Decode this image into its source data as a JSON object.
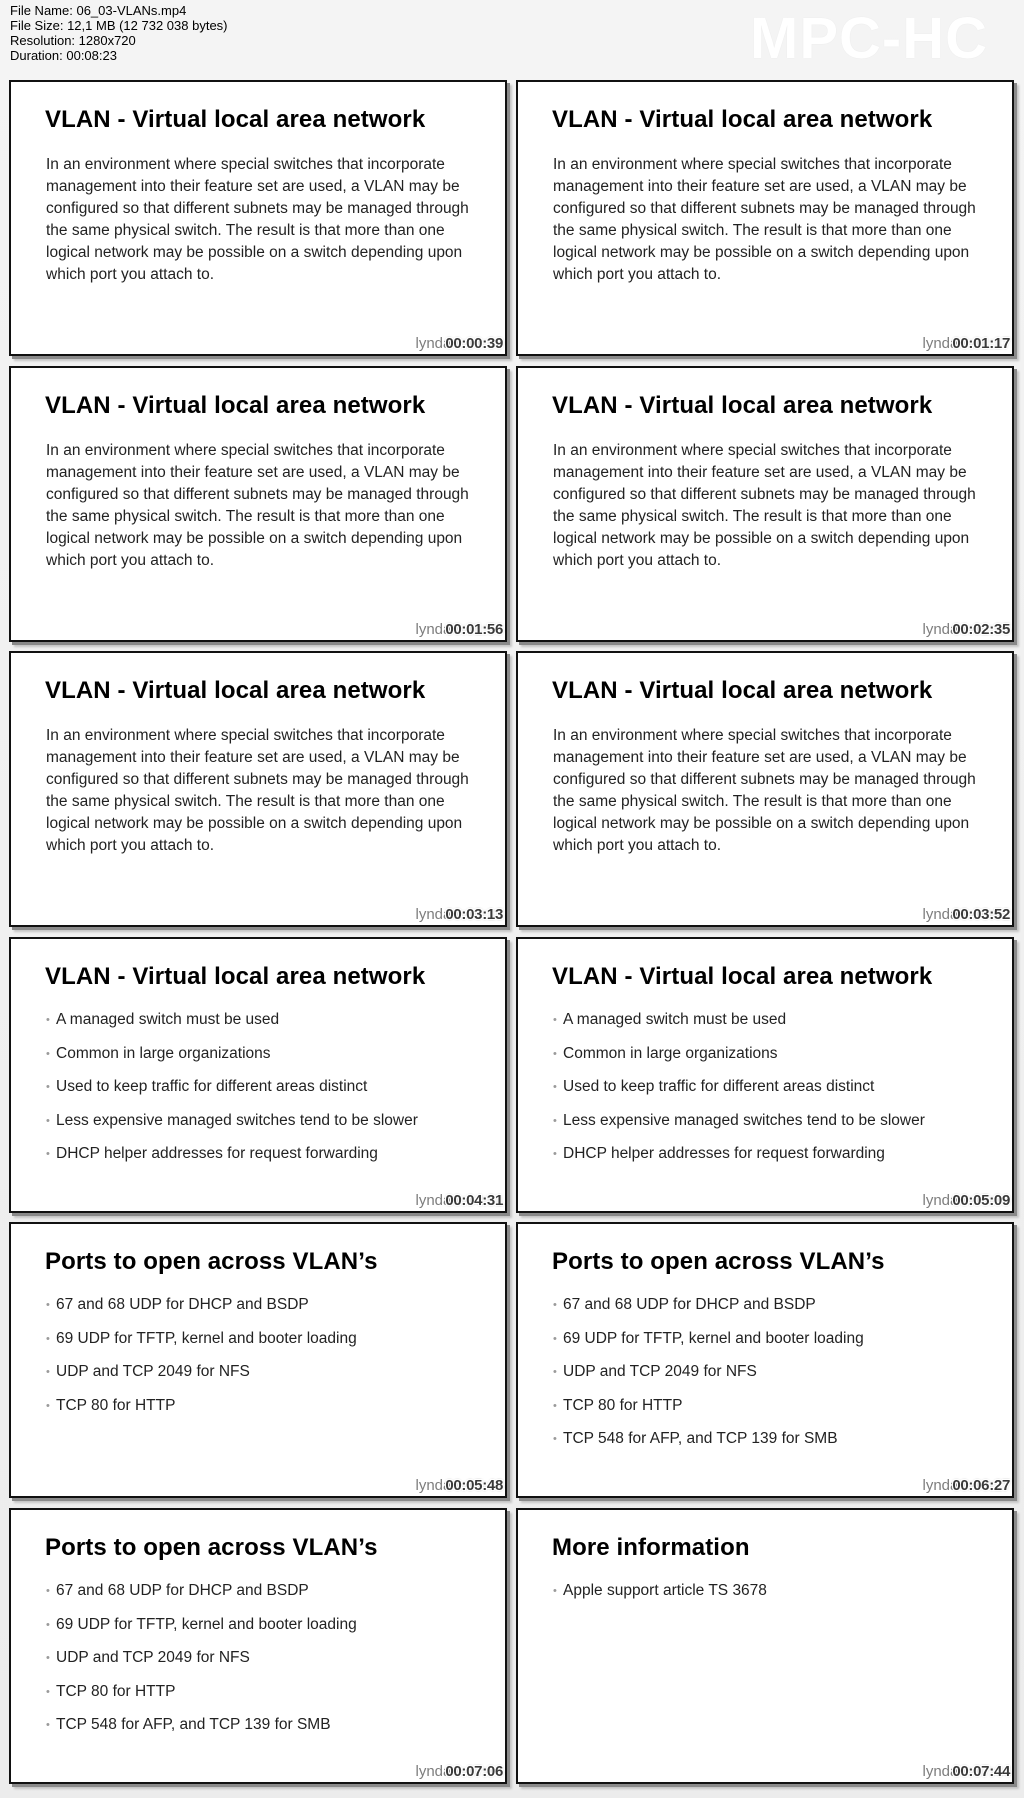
{
  "header": {
    "file_name_label": "File Name: 06_03-VLANs.mp4",
    "file_size_label": "File Size: 12,1 MB (12 732 038 bytes)",
    "resolution_label": "Resolution: 1280x720",
    "duration_label": "Duration: 00:08:23",
    "brand": "MPC-HC"
  },
  "watermark": "lynda",
  "frames": [
    {
      "title": "VLAN - Virtual local area network",
      "type": "paragraph",
      "text": "In an environment where special switches that incorporate management into their feature set are used, a VLAN may be configured so that different subnets may be managed through the same physical switch. The result is that more than one logical network may be possible on a switch depending upon which port you attach to.",
      "timestamp": "00:00:39"
    },
    {
      "title": "VLAN - Virtual local area network",
      "type": "paragraph",
      "text": "In an environment where special switches that incorporate management into their feature set are used, a VLAN may be configured so that different subnets may be managed through the same physical switch. The result is that more than one logical network may be possible on a switch depending upon which port you attach to.",
      "timestamp": "00:01:17"
    },
    {
      "title": "VLAN - Virtual local area network",
      "type": "paragraph",
      "text": "In an environment where special switches that incorporate management into their feature set are used, a VLAN may be configured so that different subnets may be managed through the same physical switch. The result is that more than one logical network may be possible on a switch depending upon which port you attach to.",
      "timestamp": "00:01:56"
    },
    {
      "title": "VLAN - Virtual local area network",
      "type": "paragraph",
      "text": "In an environment where special switches that incorporate management into their feature set are used, a VLAN may be configured so that different subnets may be managed through the same physical switch. The result is that more than one logical network may be possible on a switch depending upon which port you attach to.",
      "timestamp": "00:02:35"
    },
    {
      "title": "VLAN - Virtual local area network",
      "type": "paragraph",
      "text": "In an environment where special switches that incorporate management into their feature set are used, a VLAN may be configured so that different subnets may be managed through the same physical switch. The result is that more than one logical network may be possible on a switch depending upon which port you attach to.",
      "timestamp": "00:03:13"
    },
    {
      "title": "VLAN - Virtual local area network",
      "type": "paragraph",
      "text": "In an environment where special switches that incorporate management into their feature set are used, a VLAN may be configured so that different subnets may be managed through the same physical switch. The result is that more than one logical network may be possible on a switch depending upon which port you attach to.",
      "timestamp": "00:03:52"
    },
    {
      "title": "VLAN - Virtual local area network",
      "type": "bullets",
      "bullets": [
        "A managed switch must be used",
        "Common in large organizations",
        "Used to keep traffic for different areas distinct",
        "Less expensive managed switches tend to be slower",
        "DHCP helper addresses for request forwarding"
      ],
      "timestamp": "00:04:31"
    },
    {
      "title": "VLAN - Virtual local area network",
      "type": "bullets",
      "bullets": [
        "A managed switch must be used",
        "Common in large organizations",
        "Used to keep traffic for different areas distinct",
        "Less expensive managed switches tend to be slower",
        "DHCP helper addresses for request forwarding"
      ],
      "timestamp": "00:05:09"
    },
    {
      "title": "Ports to open across VLAN’s",
      "type": "bullets",
      "bullets": [
        "67 and 68 UDP for DHCP and BSDP",
        "69 UDP for TFTP, kernel and booter loading",
        "UDP and TCP 2049 for NFS",
        "TCP 80 for HTTP"
      ],
      "timestamp": "00:05:48"
    },
    {
      "title": "Ports to open across VLAN’s",
      "type": "bullets",
      "bullets": [
        "67 and 68 UDP for DHCP and BSDP",
        "69 UDP for TFTP, kernel and booter loading",
        "UDP and TCP 2049 for NFS",
        "TCP 80 for HTTP",
        "TCP 548 for AFP, and TCP 139 for SMB"
      ],
      "timestamp": "00:06:27"
    },
    {
      "title": "Ports to open across VLAN’s",
      "type": "bullets",
      "bullets": [
        "67 and 68 UDP for DHCP and BSDP",
        "69 UDP for TFTP, kernel and booter loading",
        "UDP and TCP 2049 for NFS",
        "TCP 80 for HTTP",
        "TCP 548 for AFP, and TCP 139 for SMB"
      ],
      "timestamp": "00:07:06"
    },
    {
      "title": "More information",
      "type": "bullets",
      "bullets": [
        "Apple support article TS 3678"
      ],
      "timestamp": "00:07:44"
    }
  ]
}
